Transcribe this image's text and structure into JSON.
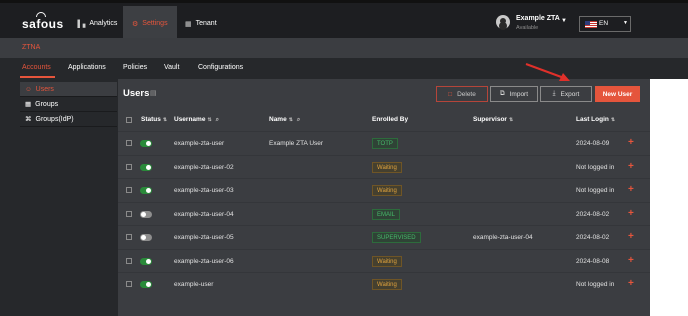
{
  "topbar": {
    "logo": "safous",
    "nav": [
      {
        "label": "Analytics",
        "icon": "bar-chart-icon"
      },
      {
        "label": "Settings",
        "icon": "gear-icon"
      },
      {
        "label": "Tenant",
        "icon": "building-icon"
      }
    ],
    "user": {
      "name": "Example ZTA",
      "status": "Available"
    },
    "language": "EN",
    "accent_color": "#e5553c"
  },
  "section": {
    "title": "ZTNA"
  },
  "subnav": {
    "tabs": [
      "Accounts",
      "Applications",
      "Policies",
      "Vault",
      "Configurations"
    ],
    "active": "Accounts"
  },
  "sidebar": {
    "items": [
      "Users",
      "Groups",
      "Groups(IdP)"
    ],
    "active": "Users"
  },
  "main": {
    "title": "Users",
    "buttons": {
      "delete": "Delete",
      "import": "Import",
      "export": "Export",
      "new_user": "New User"
    }
  },
  "table": {
    "columns": {
      "status": "Status",
      "username": "Username",
      "name": "Name",
      "enrolled_by": "Enrolled By",
      "supervisor": "Supervisor",
      "last_login": "Last Login"
    },
    "rows": [
      {
        "status": "on",
        "username": "example-zta-user",
        "name": "Example ZTA User",
        "enrolled_by": "TOTP",
        "enrolled_color": "green",
        "supervisor": "",
        "last_login": "2024-08-09"
      },
      {
        "status": "on",
        "username": "example-zta-user-02",
        "name": "",
        "enrolled_by": "Waiting",
        "enrolled_color": "orange",
        "supervisor": "",
        "last_login": "Not logged in"
      },
      {
        "status": "on",
        "username": "example-zta-user-03",
        "name": "",
        "enrolled_by": "Waiting",
        "enrolled_color": "orange",
        "supervisor": "",
        "last_login": "Not logged in"
      },
      {
        "status": "off",
        "username": "example-zta-user-04",
        "name": "",
        "enrolled_by": "EMAIL",
        "enrolled_color": "green",
        "supervisor": "",
        "last_login": "2024-08-02"
      },
      {
        "status": "off",
        "username": "example-zta-user-05",
        "name": "",
        "enrolled_by": "SUPERVISED",
        "enrolled_color": "green",
        "supervisor": "example-zta-user-04",
        "last_login": "2024-08-02"
      },
      {
        "status": "on",
        "username": "example-zta-user-06",
        "name": "",
        "enrolled_by": "Waiting",
        "enrolled_color": "orange",
        "supervisor": "",
        "last_login": "2024-08-08"
      },
      {
        "status": "on",
        "username": "example-user",
        "name": "",
        "enrolled_by": "Waiting",
        "enrolled_color": "orange",
        "supervisor": "",
        "last_login": "Not logged in"
      }
    ]
  }
}
